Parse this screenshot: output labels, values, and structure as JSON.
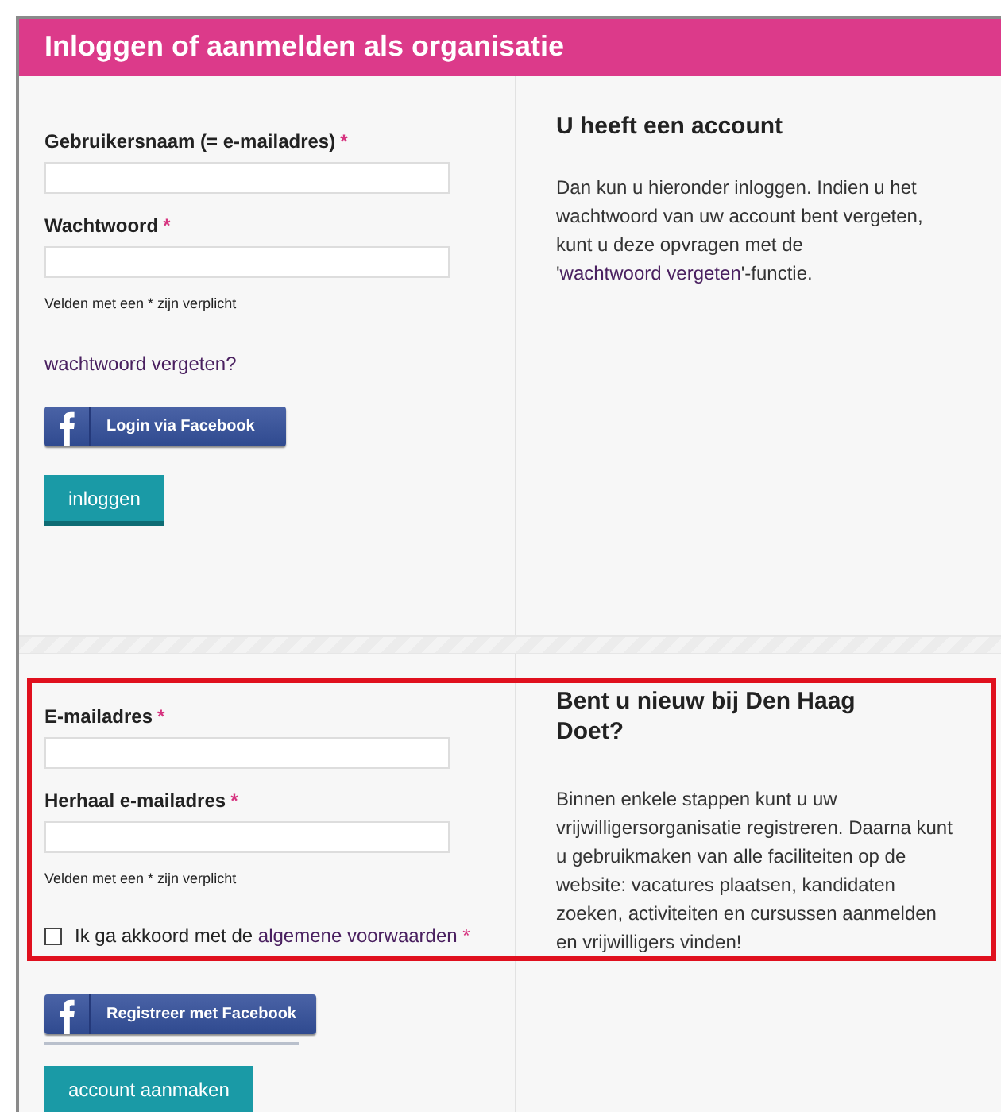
{
  "title": "Inloggen of aanmelden als organisatie",
  "login": {
    "fields": [
      {
        "label": "Gebruikersnaam (= e-mailadres)",
        "required_mark": "*"
      },
      {
        "label": "Wachtwoord",
        "required_mark": "*"
      }
    ],
    "note": "Velden met een * zijn verplicht",
    "forgot_link": "wachtwoord vergeten?",
    "facebook_button": "Login via Facebook",
    "submit_button": "inloggen"
  },
  "login_info": {
    "heading": "U heeft een account",
    "text_before": "Dan kun u hieronder inloggen. Indien u het wachtwoord van uw account bent vergeten, kunt u deze opvragen met de '",
    "link": "wachtwoord vergeten",
    "text_after": "'-functie."
  },
  "register": {
    "fields": [
      {
        "label": "E-mailadres",
        "required_mark": "*"
      },
      {
        "label": "Herhaal e-mailadres",
        "required_mark": "*"
      }
    ],
    "note": "Velden met een * zijn verplicht",
    "agreement": {
      "checked": false,
      "text": "Ik ga akkoord met de ",
      "link": "algemene voorwaarden",
      "required_mark": "*"
    },
    "facebook_button": "Registreer met Facebook",
    "submit_button": "account aanmaken"
  },
  "register_info": {
    "heading": "Bent u nieuw bij Den Haag Doet?",
    "text": "Binnen enkele stappen kunt u uw vrijwilligersorganisatie registreren. Daarna kunt u gebruikmaken van alle faciliteiten op de website: vacatures plaatsen, kandidaten zoeken, activiteiten en cursussen aanmelden en vrijwilligers vinden!"
  }
}
